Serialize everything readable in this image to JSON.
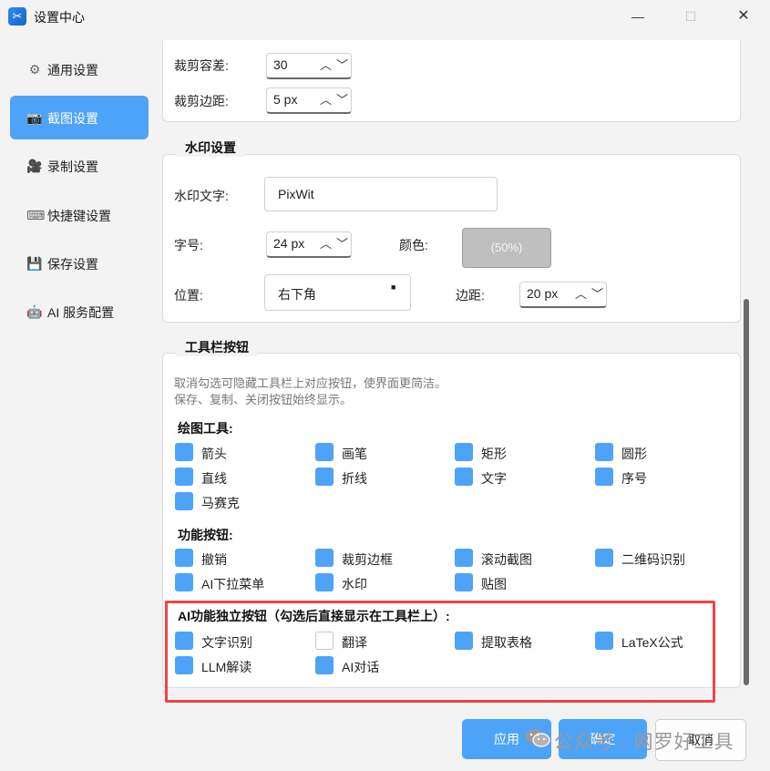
{
  "window": {
    "title": "设置中心",
    "icon": "app-scissors-icon",
    "minimize": "—",
    "maximize": "☐",
    "close": "✕"
  },
  "sidebar": {
    "items": [
      {
        "label": "通用设置",
        "icon": "gear-icon",
        "glyph": "⚙",
        "active": false
      },
      {
        "label": "截图设置",
        "icon": "camera-icon",
        "glyph": "📷",
        "active": true
      },
      {
        "label": "录制设置",
        "icon": "video-camera-icon",
        "glyph": "🎥",
        "active": false
      },
      {
        "label": "快捷键设置",
        "icon": "keyboard-icon",
        "glyph": "⌨",
        "active": false
      },
      {
        "label": "保存设置",
        "icon": "floppy-disk-icon",
        "glyph": "💾",
        "active": false
      },
      {
        "label": "AI 服务配置",
        "icon": "robot-icon",
        "glyph": "🤖",
        "active": false
      }
    ]
  },
  "crop": {
    "tolerance_label": "裁剪容差:",
    "tolerance_value": "30",
    "margin_label": "裁剪边距:",
    "margin_value": "5 px"
  },
  "watermark_settings": {
    "group_title": "水印设置",
    "text_label": "水印文字:",
    "text_value": "PixWit",
    "size_label": "字号:",
    "size_value": "24 px",
    "color_label": "颜色:",
    "color_value": "(50%)",
    "position_label": "位置:",
    "position_value": "右下角",
    "margin_label": "边距:",
    "margin_value": "20 px"
  },
  "toolbar_buttons": {
    "group_title": "工具栏按钮",
    "hint_line1": "取消勾选可隐藏工具栏上对应按钮，使界面更简洁。",
    "hint_line2": "保存、复制、关闭按钮始终显示。",
    "drawing_title": "绘图工具:",
    "drawing": [
      {
        "label": "箭头",
        "checked": true
      },
      {
        "label": "画笔",
        "checked": true
      },
      {
        "label": "矩形",
        "checked": true
      },
      {
        "label": "圆形",
        "checked": true
      },
      {
        "label": "直线",
        "checked": true
      },
      {
        "label": "折线",
        "checked": true
      },
      {
        "label": "文字",
        "checked": true
      },
      {
        "label": "序号",
        "checked": true
      },
      {
        "label": "马赛克",
        "checked": true
      }
    ],
    "function_title": "功能按钮:",
    "functions": [
      {
        "label": "撤销",
        "checked": true
      },
      {
        "label": "裁剪边框",
        "checked": true
      },
      {
        "label": "滚动截图",
        "checked": true
      },
      {
        "label": "二维码识别",
        "checked": true
      },
      {
        "label": "AI下拉菜单",
        "checked": true
      },
      {
        "label": "水印",
        "checked": true
      },
      {
        "label": "贴图",
        "checked": true
      }
    ],
    "ai_title": "AI功能独立按钮（勾选后直接显示在工具栏上）:",
    "ai": [
      {
        "label": "文字识别",
        "checked": true
      },
      {
        "label": "翻译",
        "checked": false
      },
      {
        "label": "提取表格",
        "checked": true
      },
      {
        "label": "LaTeX公式",
        "checked": true
      },
      {
        "label": "LLM解读",
        "checked": true
      },
      {
        "label": "AI对话",
        "checked": true
      }
    ]
  },
  "footer": {
    "apply": "应用",
    "ok": "确定",
    "cancel": "取消"
  },
  "overlay": {
    "text": "公众号 · 网罗好工具",
    "icon": "wechat-icon"
  },
  "colors": {
    "accent": "#4da3f7",
    "highlight_frame": "#ef4444"
  }
}
